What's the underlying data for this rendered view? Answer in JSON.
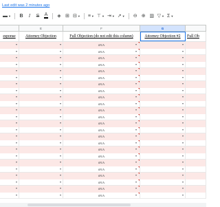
{
  "last_edit": "Last edit was 2 minutes ago",
  "toolbar": {
    "items": [
      {
        "name": "text-format-icon",
        "glyph": "▬"
      },
      {
        "name": "bold-button",
        "glyph": "B"
      },
      {
        "name": "italic-button",
        "glyph": "I"
      },
      {
        "name": "strikethrough-button",
        "glyph": "S"
      },
      {
        "name": "text-color-button",
        "glyph": "A"
      },
      {
        "name": "fill-color-icon",
        "glyph": "◈"
      },
      {
        "name": "borders-icon",
        "glyph": "⊞"
      },
      {
        "name": "merge-icon",
        "glyph": "⊟"
      },
      {
        "name": "horizontal-align-icon",
        "glyph": "≡"
      },
      {
        "name": "vertical-align-icon",
        "glyph": "⊥"
      },
      {
        "name": "text-wrap-icon",
        "glyph": "⇥"
      },
      {
        "name": "text-rotation-icon",
        "glyph": "↗"
      },
      {
        "name": "link-icon",
        "glyph": "⊖"
      },
      {
        "name": "comment-icon",
        "glyph": "⊕"
      },
      {
        "name": "chart-icon",
        "glyph": "▥"
      },
      {
        "name": "filter-icon",
        "glyph": "▽"
      },
      {
        "name": "functions-icon",
        "glyph": "Σ"
      }
    ]
  },
  "columns": {
    "letters": [
      "",
      "E",
      "F",
      "G",
      ""
    ],
    "headers": [
      "esponse",
      "Attorney Objection",
      "Full Objection (do not edit this column)",
      "Attorney Objection #2",
      "Full Ob"
    ]
  },
  "cell_value": "#N/A",
  "row_count": 24,
  "colors": {
    "pink_fill": "#fce8e6",
    "selection": "#1a73e8",
    "error_marker": "#d93025"
  }
}
